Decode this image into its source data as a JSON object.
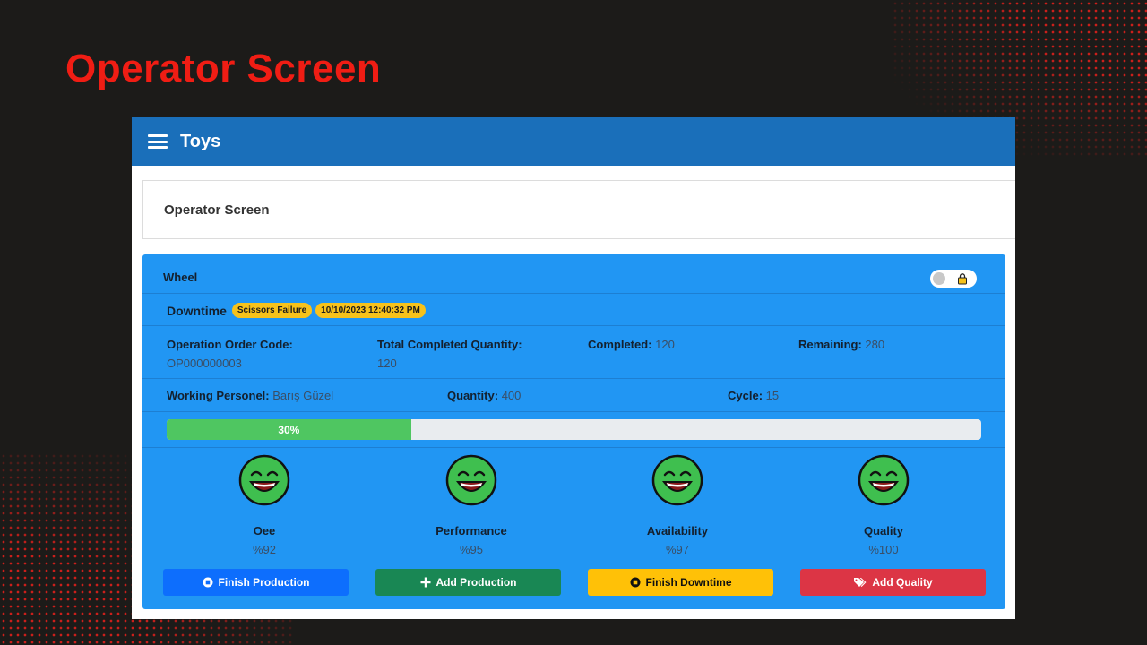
{
  "slide": {
    "title": "Operator Screen"
  },
  "navbar": {
    "title": "Toys",
    "menu_icon": "hamburger-menu-icon"
  },
  "page": {
    "header": "Operator Screen"
  },
  "card": {
    "title": "Wheel",
    "toggle_icon": "lock-icon",
    "downtime": {
      "label": "Downtime",
      "reason": "Scissors Failure",
      "timestamp": "10/10/2023 12:40:32 PM"
    },
    "order": {
      "code_label": "Operation Order Code:",
      "code_value": "OP000000003",
      "total_label": "Total Completed Quantity:",
      "total_value": "120",
      "completed_label": "Completed:",
      "completed_value": "120",
      "remaining_label": "Remaining:",
      "remaining_value": "280"
    },
    "personnel": {
      "working_label": "Working Personel:",
      "working_value": "Barış Güzel",
      "quantity_label": "Quantity:",
      "quantity_value": "400",
      "cycle_label": "Cycle:",
      "cycle_value": "15"
    },
    "progress": {
      "percent": 30,
      "label": "30%"
    },
    "metrics": [
      {
        "name": "Oee",
        "value": "%92",
        "icon": "smiley-face-icon"
      },
      {
        "name": "Performance",
        "value": "%95",
        "icon": "smiley-face-icon"
      },
      {
        "name": "Availability",
        "value": "%97",
        "icon": "smiley-face-icon"
      },
      {
        "name": "Quality",
        "value": "%100",
        "icon": "smiley-face-icon"
      }
    ],
    "buttons": [
      {
        "label": "Finish Production",
        "icon": "stop-circle-icon",
        "color": "#0d6efd"
      },
      {
        "label": "Add Production",
        "icon": "plus-icon",
        "color": "#198754"
      },
      {
        "label": "Finish Downtime",
        "icon": "stop-circle-icon",
        "color": "#ffc107"
      },
      {
        "label": "Add Quality",
        "icon": "tags-icon",
        "color": "#dc3545"
      }
    ]
  },
  "colors": {
    "slide_bg": "#1c1b19",
    "accent_red": "#f01d14",
    "navbar": "#1a6fba",
    "card": "#2196f3",
    "progress_fill": "#4fc661",
    "badge": "#f7c21b"
  }
}
